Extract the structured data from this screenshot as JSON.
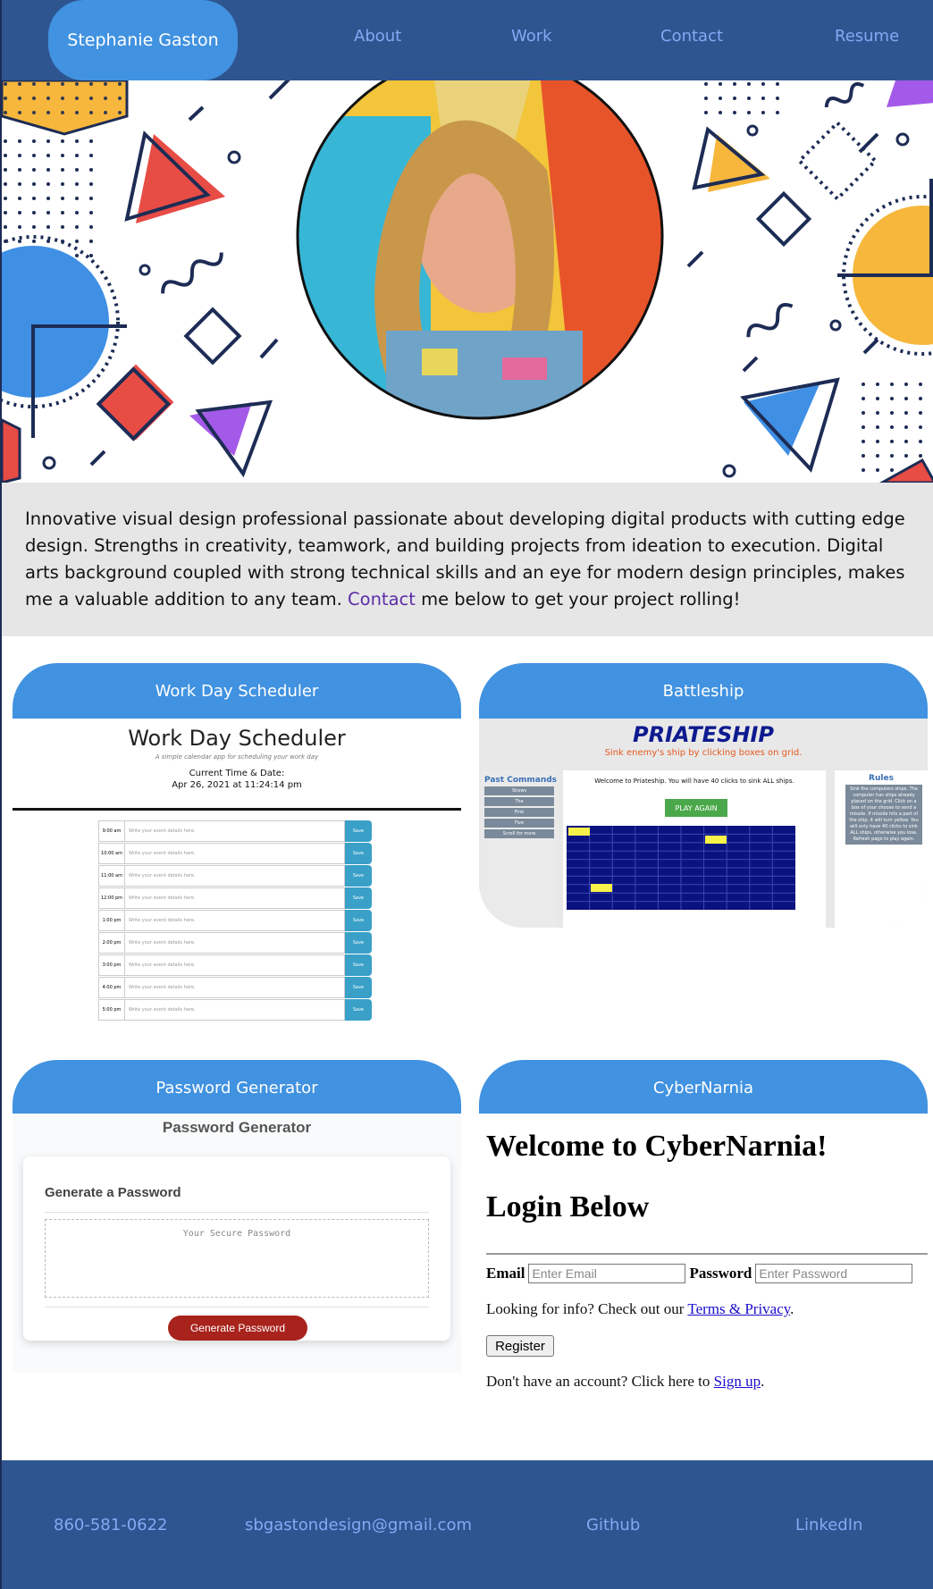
{
  "nav": {
    "brand": "Stephanie Gaston",
    "links": [
      "About",
      "Work",
      "Contact",
      "Resume"
    ]
  },
  "intro": {
    "text_before": "Innovative visual design professional passionate about developing digital products with cutting edge design. Strengths in creativity, teamwork, and building projects from ideation to execution. Digital arts background coupled with strong technical skills and an eye for modern design principles, makes me a valuable addition to any team. ",
    "link": "Contact",
    "text_after": " me below to get your project rolling!"
  },
  "projects": [
    {
      "title": "Work Day Scheduler",
      "preview": {
        "heading": "Work Day Scheduler",
        "subtitle": "A simple calendar app for scheduling your work day",
        "time_label": "Current Time & Date:",
        "time_value": "Apr 26, 2021 at 11:24:14 pm",
        "hours": [
          "9:00 am",
          "10:00 am",
          "11:00 am",
          "12:00 pm",
          "1:00 pm",
          "2:00 pm",
          "3:00 pm",
          "4:00 pm",
          "5:00 pm"
        ],
        "event_placeholder": "Write your event details here.",
        "save_label": "Save"
      }
    },
    {
      "title": "Battleship",
      "preview": {
        "logo": "PRIATESHIP",
        "tagline": "Sink enemy's ship by clicking boxes on grid.",
        "commands_title": "Past Commands",
        "commands": [
          "Shows",
          "The",
          "First",
          "Five",
          "Scroll for more"
        ],
        "welcome": "Welcome to Priateship. You will have 40 clicks to sink ALL ships.",
        "play_again": "PLAY AGAIN",
        "rules_title": "Rules",
        "rules_text": "Sink the computers ships. The computer has ships already placed on the grid. Click on a box of your choose to send a missile. If missile hits a part of the ship, it will turn yellow. You will only have 40 clicks to sink ALL ships, otherwise you lose. Refresh page to play again."
      }
    },
    {
      "title": "Password Generator",
      "preview": {
        "heading": "Password Generator",
        "box_title": "Generate a Password",
        "placeholder": "Your Secure Password",
        "button": "Generate Password"
      }
    },
    {
      "title": "CyberNarnia",
      "preview": {
        "heading1": "Welcome to CyberNarnia!",
        "heading2": "Login Below",
        "email_label": "Email",
        "email_placeholder": "Enter Email",
        "password_label": "Password",
        "password_placeholder": "Enter Password",
        "info_text": "Looking for info? Check out our ",
        "info_link": "Terms & Privacy",
        "register": "Register",
        "signup_text": "Don't have an account? Click here to ",
        "signup_link": "Sign up"
      }
    }
  ],
  "footer": {
    "phone": "860-581-0622",
    "email": "sbgastondesign@gmail.com",
    "github": "Github",
    "linkedin": "LinkedIn"
  },
  "colors": {
    "nav_bg": "#2e5590",
    "accent": "#4192e0",
    "link": "#86a8f5"
  }
}
